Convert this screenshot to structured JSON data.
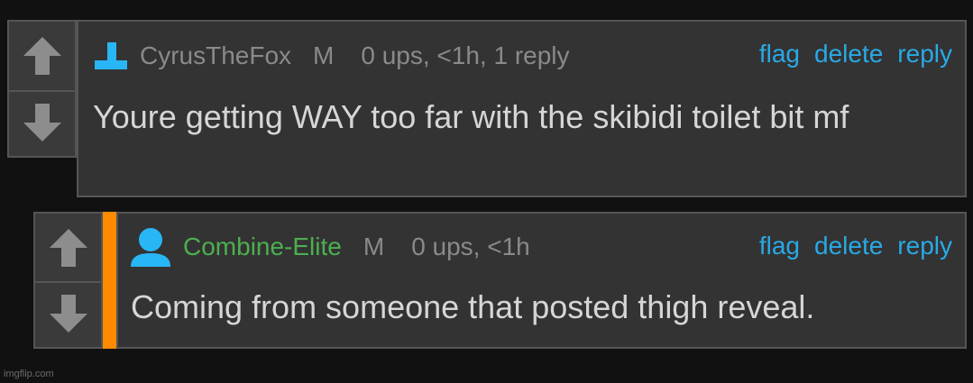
{
  "comments": [
    {
      "username": "CyrusTheFox",
      "username_color": "#8a8a8a",
      "role": "M",
      "meta": "0 ups, <1h, 1 reply",
      "text": "Youre getting WAY too far with the skibidi toilet bit mf",
      "avatar_icon": "steps-avatar-icon",
      "actions": {
        "flag": "flag",
        "delete": "delete",
        "reply": "reply"
      }
    },
    {
      "username": "Combine-Elite",
      "username_color": "#4caf50",
      "role": "M",
      "meta": "0 ups, <1h",
      "text": "Coming from someone that posted thigh reveal.",
      "avatar_icon": "user-avatar-icon",
      "actions": {
        "flag": "flag",
        "delete": "delete",
        "reply": "reply"
      }
    }
  ],
  "colors": {
    "link": "#29a9e6",
    "reply_indicator": "#ff8a00",
    "background": "#111111"
  },
  "watermark": "imgflip.com"
}
